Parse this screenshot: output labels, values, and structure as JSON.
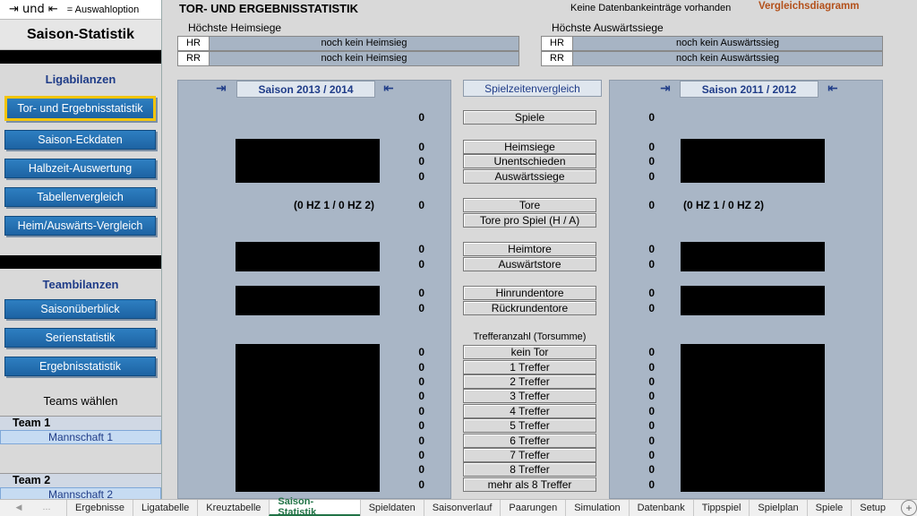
{
  "sidebar": {
    "top_hint_arrows": "⇥ und ⇤",
    "top_hint_text": "= Auswahloption",
    "title": "Saison-Statistik",
    "section1": "Ligabilanzen",
    "league_buttons": [
      "Tor- und Ergebnisstatistik",
      "Saison-Eckdaten",
      "Halbzeit-Auswertung",
      "Tabellenvergleich",
      "Heim/Auswärts-Vergleich"
    ],
    "section2": "Teambilanzen",
    "team_buttons": [
      "Saisonüberblick",
      "Serienstatistik",
      "Ergebnisstatistik"
    ],
    "teams_label": "Teams wählen",
    "team1_label": "Team 1",
    "team1_value": "Mannschaft 1",
    "team2_label": "Team 2",
    "team2_value": "Mannschaft 2"
  },
  "header": {
    "title": "TOR- UND ERGEBNISSTATISTIK",
    "status": "Keine Datenbankeinträge vorhanden",
    "compare_link": "Vergleichsdiagramm"
  },
  "home_wins": {
    "label": "Höchste Heimsiege",
    "rows": [
      {
        "code": "HR",
        "value": "noch kein Heimsieg"
      },
      {
        "code": "RR",
        "value": "noch kein Heimsieg"
      }
    ]
  },
  "away_wins": {
    "label": "Höchste Auswärtssiege",
    "rows": [
      {
        "code": "HR",
        "value": "noch kein Auswärtssieg"
      },
      {
        "code": "RR",
        "value": "noch kein Auswärtssieg"
      }
    ]
  },
  "left_season": "Saison 2013 / 2014",
  "right_season": "Saison 2011 / 2012",
  "compare_title": "Spielzeitenvergleich",
  "arrow_right": "⇥",
  "arrow_left": "⇤",
  "halftime_left": "(0 HZ 1 / 0 HZ 2)",
  "halftime_right": "(0 HZ 1 / 0 HZ 2)",
  "treffer_title": "Trefferanzahl (Torsumme)",
  "stats": [
    {
      "label": "Spiele",
      "left": "0",
      "right": "0"
    },
    {
      "label": "Heimsiege",
      "left": "0",
      "right": "0"
    },
    {
      "label": "Unentschieden",
      "left": "0",
      "right": "0"
    },
    {
      "label": "Auswärtssiege",
      "left": "0",
      "right": "0"
    },
    {
      "label": "Tore",
      "left": "0",
      "right": "0"
    },
    {
      "label": "Tore pro Spiel (H / A)",
      "left": "",
      "right": ""
    },
    {
      "label": "Heimtore",
      "left": "0",
      "right": "0"
    },
    {
      "label": "Auswärtstore",
      "left": "0",
      "right": "0"
    },
    {
      "label": "Hinrundentore",
      "left": "0",
      "right": "0"
    },
    {
      "label": "Rückrundentore",
      "left": "0",
      "right": "0"
    },
    {
      "label": "kein Tor",
      "left": "0",
      "right": "0"
    },
    {
      "label": "1 Treffer",
      "left": "0",
      "right": "0"
    },
    {
      "label": "2 Treffer",
      "left": "0",
      "right": "0"
    },
    {
      "label": "3 Treffer",
      "left": "0",
      "right": "0"
    },
    {
      "label": "4 Treffer",
      "left": "0",
      "right": "0"
    },
    {
      "label": "5 Treffer",
      "left": "0",
      "right": "0"
    },
    {
      "label": "6 Treffer",
      "left": "0",
      "right": "0"
    },
    {
      "label": "7 Treffer",
      "left": "0",
      "right": "0"
    },
    {
      "label": "8 Treffer",
      "left": "0",
      "right": "0"
    },
    {
      "label": "mehr als 8 Treffer",
      "left": "0",
      "right": "0"
    }
  ],
  "sheet_tabs": [
    "Ergebnisse",
    "Ligatabelle",
    "Kreuztabelle",
    "Saison-Statistik",
    "Spieldaten",
    "Saisonverlauf",
    "Paarungen",
    "Simulation",
    "Datenbank",
    "Tippspiel",
    "Spielplan",
    "Spiele",
    "Setup"
  ],
  "active_tab": "Saison-Statistik",
  "add_sheet": "+",
  "colors": {
    "accent_blue": "#1d63a3",
    "active_border": "#f2c40c",
    "panel": "#a9b6c6",
    "link_orange": "#b3501a"
  }
}
